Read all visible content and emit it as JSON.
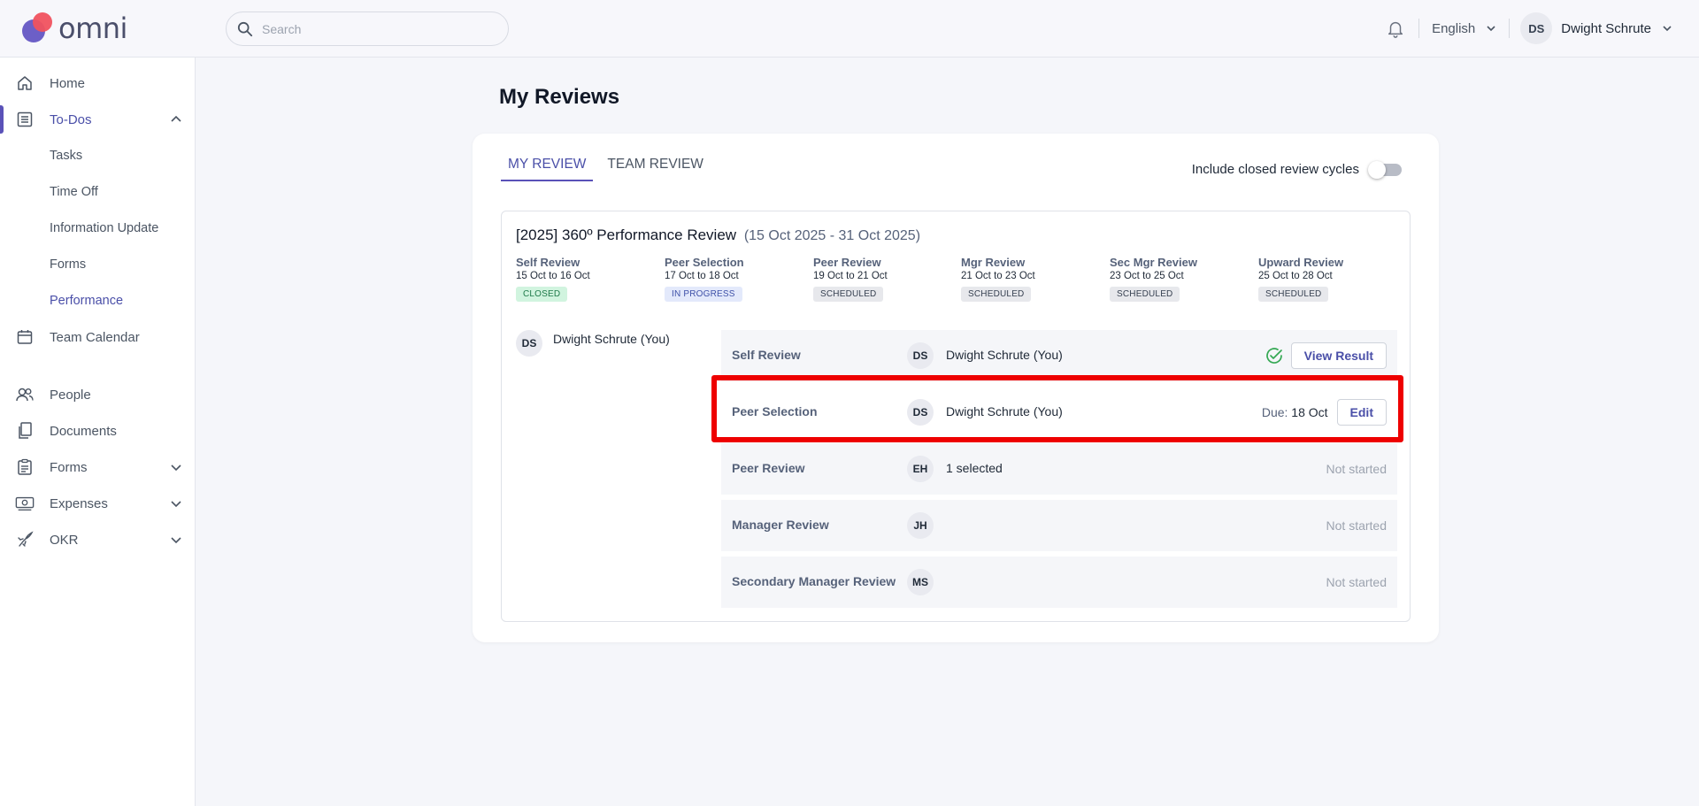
{
  "app": {
    "logo_text": "omni"
  },
  "header": {
    "search_placeholder": "Search",
    "language": "English",
    "user": {
      "initials": "DS",
      "name": "Dwight Schrute"
    }
  },
  "sidebar": {
    "home": "Home",
    "todos": "To-Dos",
    "todos_sub": [
      "Tasks",
      "Time Off",
      "Information Update",
      "Forms",
      "Performance"
    ],
    "team_calendar": "Team Calendar",
    "people": "People",
    "documents": "Documents",
    "forms": "Forms",
    "expenses": "Expenses",
    "okr": "OKR"
  },
  "page": {
    "title": "My Reviews",
    "tabs": [
      "MY REVIEW",
      "TEAM REVIEW"
    ],
    "closed_toggle_label": "Include closed review cycles"
  },
  "cycle": {
    "title": "[2025] 360º Performance Review",
    "dates": "(15 Oct 2025 - 31 Oct 2025)",
    "phases": [
      {
        "name": "Self Review",
        "dates": "15 Oct to 16 Oct",
        "status": "CLOSED"
      },
      {
        "name": "Peer Selection",
        "dates": "17 Oct to 18 Oct",
        "status": "IN PROGRESS"
      },
      {
        "name": "Peer Review",
        "dates": "19 Oct to 21 Oct",
        "status": "SCHEDULED"
      },
      {
        "name": "Mgr Review",
        "dates": "21 Oct to 23 Oct",
        "status": "SCHEDULED"
      },
      {
        "name": "Sec Mgr Review",
        "dates": "23 Oct to 25 Oct",
        "status": "SCHEDULED"
      },
      {
        "name": "Upward Review",
        "dates": "25 Oct to 28 Oct",
        "status": "SCHEDULED"
      }
    ],
    "reviewee": {
      "initials": "DS",
      "name": "Dwight Schrute (You)"
    },
    "rows": [
      {
        "name": "Self Review",
        "initials": "DS",
        "person": "Dwight Schrute (You)",
        "action": "View Result"
      },
      {
        "name": "Peer Selection",
        "initials": "DS",
        "person": "Dwight Schrute (You)",
        "due_label": "Due:",
        "due_date": "18 Oct",
        "action": "Edit"
      },
      {
        "name": "Peer Review",
        "initials": "EH",
        "person": "1 selected",
        "status": "Not started"
      },
      {
        "name": "Manager Review",
        "initials": "JH",
        "person": "",
        "status": "Not started"
      },
      {
        "name": "Secondary Manager Review",
        "initials": "MS",
        "person": "",
        "status": "Not started"
      }
    ]
  },
  "colors": {
    "accent": "#5a52b8",
    "highlight": "#ee0000",
    "closed_badge": "#d1f4df",
    "progress_badge": "#e3e9fb",
    "scheduled_badge": "#e7e8ec"
  }
}
